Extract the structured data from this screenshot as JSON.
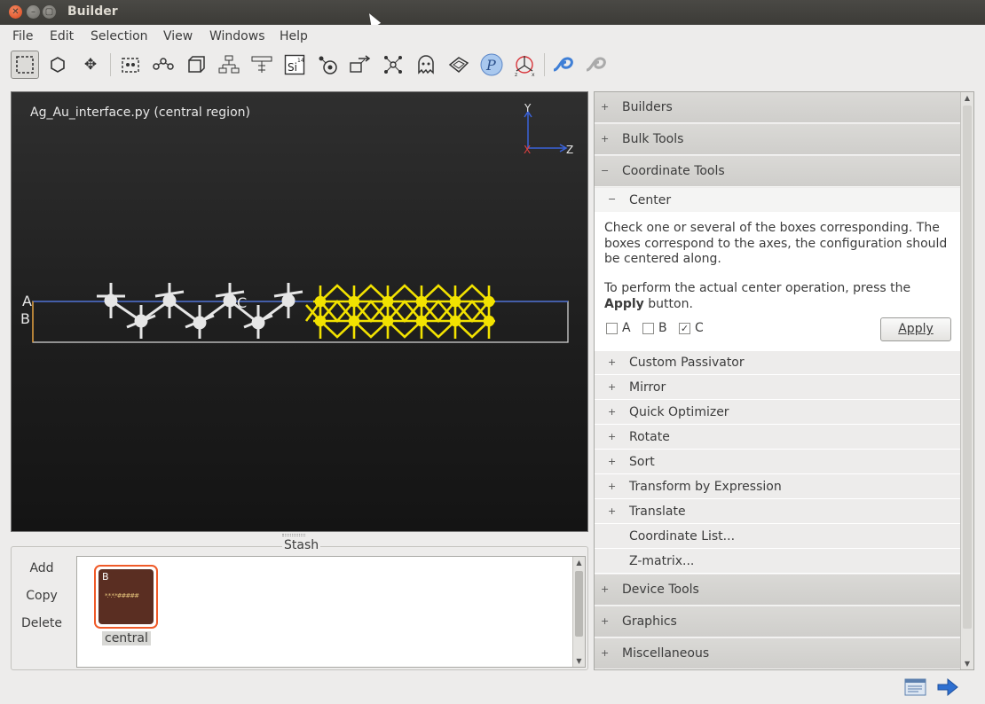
{
  "window": {
    "title": "Builder"
  },
  "menu": [
    "File",
    "Edit",
    "Selection",
    "View",
    "Windows",
    "Help"
  ],
  "toolbar": {
    "tools": [
      {
        "name": "select-rectangle-icon",
        "glyph": "⬚"
      },
      {
        "name": "hexagon-icon",
        "glyph": "⬡"
      },
      {
        "name": "move-icon",
        "glyph": "✥"
      },
      {
        "name": "box-select-icon",
        "glyph": "▨"
      },
      {
        "name": "chain-icon",
        "glyph": "⚯"
      },
      {
        "name": "cell-icon",
        "glyph": "◫"
      },
      {
        "name": "tree-icon",
        "glyph": "⊤"
      },
      {
        "name": "grid-icon",
        "glyph": "⊞"
      },
      {
        "name": "element-icon",
        "glyph": "Si"
      },
      {
        "name": "atom-icon",
        "glyph": "⊛"
      },
      {
        "name": "transform-icon",
        "glyph": "⇱"
      },
      {
        "name": "network-icon",
        "glyph": "✳"
      },
      {
        "name": "ghost-icon",
        "glyph": "ᗣ"
      },
      {
        "name": "surface-icon",
        "glyph": "◈"
      },
      {
        "name": "python-icon",
        "glyph": "ℙ"
      },
      {
        "name": "axes-icon",
        "glyph": "⟲"
      },
      {
        "name": "loop-icon",
        "glyph": "➰"
      },
      {
        "name": "loop-gray-icon",
        "glyph": "➰"
      }
    ]
  },
  "viewport": {
    "label": "Ag_Au_interface.py (central region)",
    "axis_y": "Y",
    "axis_x": "X",
    "axis_z": "Z",
    "label_a": "A",
    "label_b": "B",
    "label_c": "C"
  },
  "stash": {
    "title": "Stash",
    "buttons": [
      "Add",
      "Copy",
      "Delete"
    ],
    "item": {
      "badge": "B",
      "label": "central",
      "preview": "*.*.*.*#####"
    }
  },
  "panel": {
    "builders": "Builders",
    "bulk_tools": "Bulk Tools",
    "coordinate_tools": "Coordinate Tools",
    "center": "Center",
    "center_desc": "Check one or several of the boxes corresponding. The boxes correspond to the axes, the configuration should be centered along.",
    "center_desc2_pre": "To perform the actual center operation, press the ",
    "center_desc2_bold": "Apply",
    "center_desc2_post": " button.",
    "check_a": "A",
    "check_b": "B",
    "check_c": "C",
    "checked_c": "✓",
    "apply": "Apply",
    "sub_items": [
      "Custom Passivator",
      "Mirror",
      "Quick Optimizer",
      "Rotate",
      "Sort",
      "Transform by Expression",
      "Translate"
    ],
    "plain_items": [
      "Coordinate List...",
      "Z-matrix..."
    ],
    "device_tools": "Device Tools",
    "graphics": "Graphics",
    "miscellaneous": "Miscellaneous",
    "expand": "+",
    "collapse": "−"
  },
  "colors": {
    "silver_atom": "#e6e6e6",
    "gold_atom": "#f2e200",
    "cell_line": "#d0d0d0",
    "axis_line": "#3b63d9",
    "accent": "#f05a28"
  }
}
